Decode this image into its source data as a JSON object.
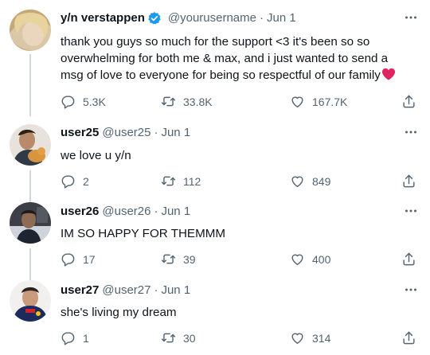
{
  "colors": {
    "verified": "#1d9bf0",
    "heart_emoji": "#e0245e",
    "secondary_text": "#536471",
    "thread_line": "#cfd9de"
  },
  "tweets": [
    {
      "name": "y/n verstappen",
      "verified": true,
      "handle": "@yourusername",
      "date": "Jun 1",
      "text_lines": [
        "thank you guys so much for the support <3 it's been so so",
        "overwhelming for both me & max, and i just wanted to send a",
        "msg of love to everyone for being so respectful of our family"
      ],
      "emoji": "red-heart",
      "replies": "5.3K",
      "retweets": "33.8K",
      "likes": "167.7K"
    },
    {
      "name": "user25",
      "handle": "@user25",
      "date": "Jun 1",
      "text_lines": [
        "we love u y/n"
      ],
      "replies": "2",
      "retweets": "112",
      "likes": "849"
    },
    {
      "name": "user26",
      "handle": "@user26",
      "date": "Jun 1",
      "text_lines": [
        "IM SO HAPPY FOR THEMMM"
      ],
      "replies": "17",
      "retweets": "39",
      "likes": "400"
    },
    {
      "name": "user27",
      "handle": "@user27",
      "date": "Jun 1",
      "text_lines": [
        "she's living my dream"
      ],
      "replies": "1",
      "retweets": "30",
      "likes": "314"
    }
  ]
}
